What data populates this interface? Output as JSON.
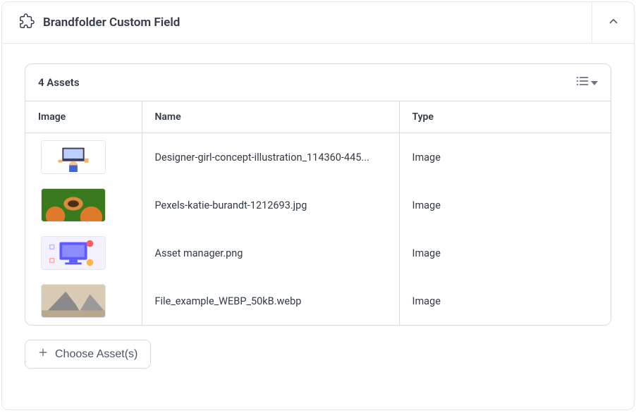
{
  "header": {
    "title": "Brandfolder Custom Field"
  },
  "assets": {
    "count_label": "4 Assets",
    "columns": {
      "image": "Image",
      "name": "Name",
      "type": "Type"
    },
    "rows": [
      {
        "name": "Designer-girl-concept-illustration_114360-445...",
        "type": "Image"
      },
      {
        "name": "Pexels-katie-burandt-1212693.jpg",
        "type": "Image"
      },
      {
        "name": "Asset manager.png",
        "type": "Image"
      },
      {
        "name": "File_example_WEBP_50kB.webp",
        "type": "Image"
      }
    ]
  },
  "actions": {
    "choose_label": "Choose Asset(s)"
  }
}
